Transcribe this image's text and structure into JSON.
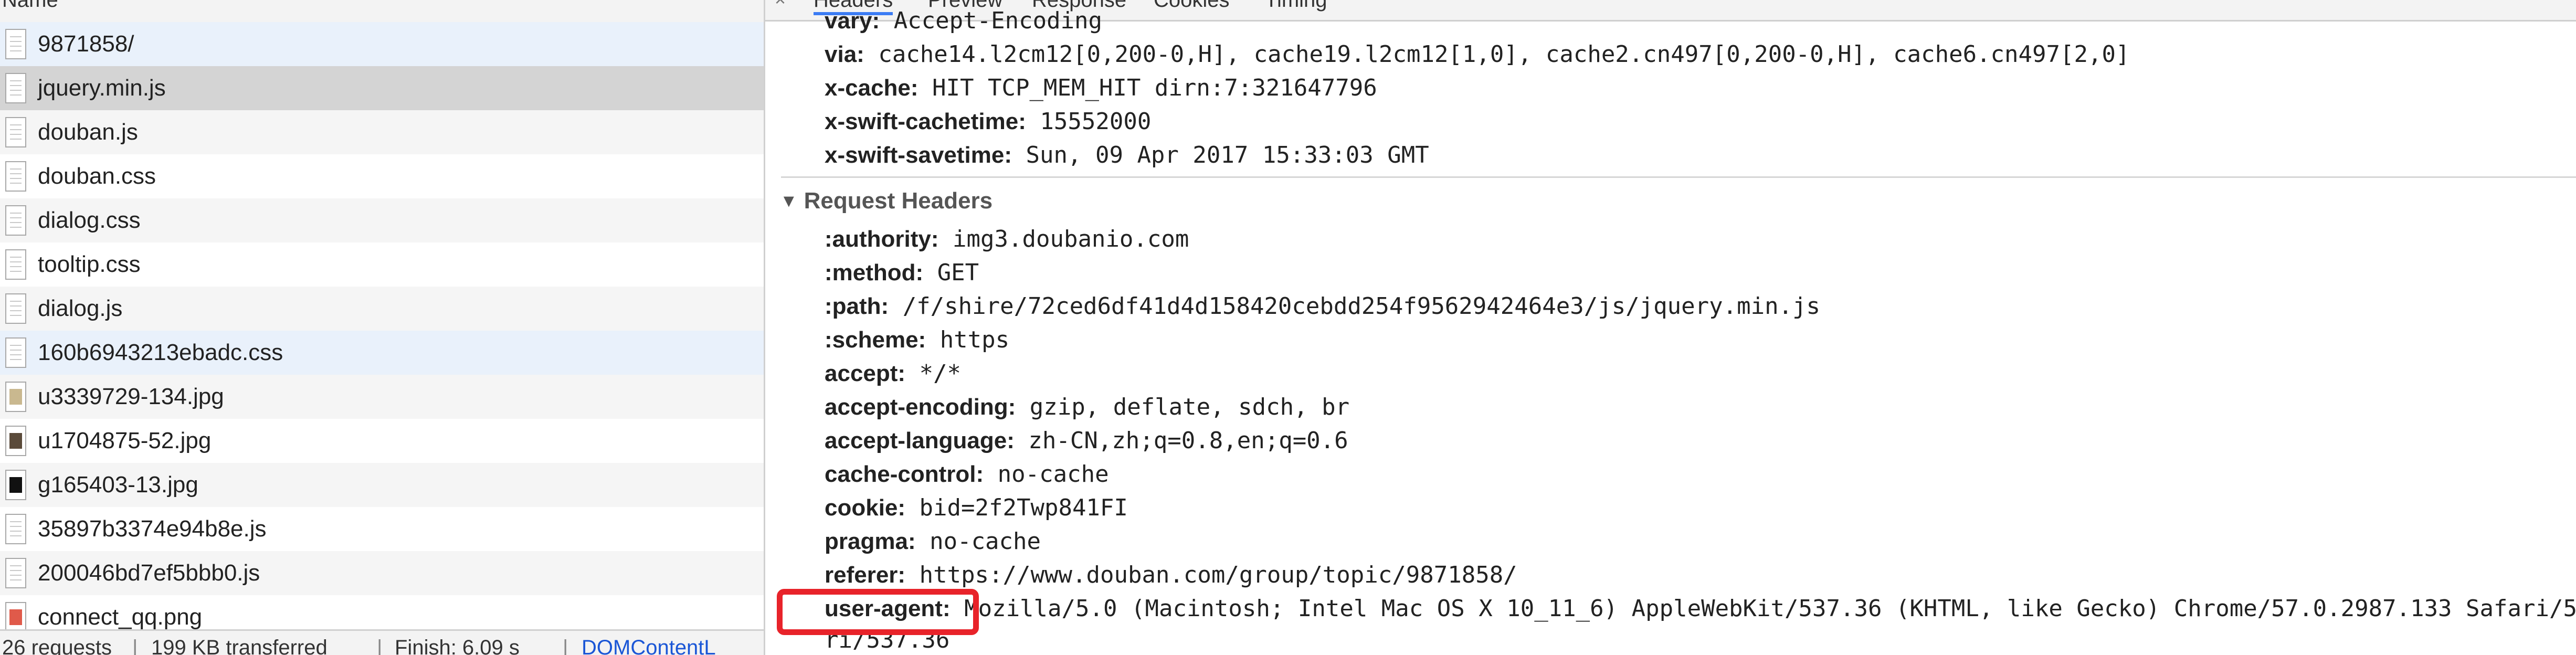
{
  "left_panel": {
    "header_label": "Name",
    "files": [
      {
        "name": "9871858/",
        "type": "doc",
        "bg": "#e9f1fb"
      },
      {
        "name": "jquery.min.js",
        "type": "doc",
        "bg": "#d4d4d4"
      },
      {
        "name": "douban.js",
        "type": "doc",
        "bg": "#f5f5f5"
      },
      {
        "name": "douban.css",
        "type": "doc",
        "bg": "#ffffff"
      },
      {
        "name": "dialog.css",
        "type": "doc",
        "bg": "#f5f5f5"
      },
      {
        "name": "tooltip.css",
        "type": "doc",
        "bg": "#ffffff"
      },
      {
        "name": "dialog.js",
        "type": "doc",
        "bg": "#f5f5f5"
      },
      {
        "name": "160b6943213ebadc.css",
        "type": "doc",
        "bg": "#e9f1fb"
      },
      {
        "name": "u3339729-134.jpg",
        "type": "img",
        "thumb": "#c9b88f",
        "bg": "#f5f5f5"
      },
      {
        "name": "u1704875-52.jpg",
        "type": "img",
        "thumb": "#5a4a3a",
        "bg": "#ffffff"
      },
      {
        "name": "g165403-13.jpg",
        "type": "img",
        "thumb": "#111111",
        "bg": "#f5f5f5"
      },
      {
        "name": "35897b3374e94b8e.js",
        "type": "doc",
        "bg": "#ffffff"
      },
      {
        "name": "200046bd7ef5bbb0.js",
        "type": "doc",
        "bg": "#f5f5f5"
      },
      {
        "name": "connect_qq.png",
        "type": "img",
        "thumb": "#e05a4a",
        "bg": "#ffffff"
      }
    ],
    "footer": {
      "requests": "26 requests",
      "transferred": "199 KB transferred",
      "finish": "Finish: 6.09 s",
      "dcl": "DOMContentL",
      "separator": "|"
    }
  },
  "tabs": {
    "headers": "Headers",
    "preview": "Preview",
    "response": "Response",
    "cookies": "Cookies",
    "timing": "Timing",
    "close": "×"
  },
  "response_headers": [
    {
      "key": "vary:",
      "value": "Accept-Encoding"
    },
    {
      "key": "via:",
      "value": "cache14.l2cm12[0,200-0,H], cache19.l2cm12[1,0], cache2.cn497[0,200-0,H], cache6.cn497[2,0]"
    },
    {
      "key": "x-cache:",
      "value": "HIT TCP_MEM_HIT dirn:7:321647796"
    },
    {
      "key": "x-swift-cachetime:",
      "value": "15552000"
    },
    {
      "key": "x-swift-savetime:",
      "value": "Sun, 09 Apr 2017 15:33:03 GMT"
    }
  ],
  "request_section": {
    "title": "Request Headers",
    "toggle": "▼",
    "headers": [
      {
        "key": ":authority:",
        "value": "img3.doubanio.com"
      },
      {
        "key": ":method:",
        "value": "GET"
      },
      {
        "key": ":path:",
        "value": "/f/shire/72ced6df41d4d158420cebdd254f9562942464e3/js/jquery.min.js"
      },
      {
        "key": ":scheme:",
        "value": "https"
      },
      {
        "key": "accept:",
        "value": "*/*"
      },
      {
        "key": "accept-encoding:",
        "value": "gzip, deflate, sdch, br"
      },
      {
        "key": "accept-language:",
        "value": "zh-CN,zh;q=0.8,en;q=0.6"
      },
      {
        "key": "cache-control:",
        "value": "no-cache"
      },
      {
        "key": "cookie:",
        "value": "bid=2f2Twp841FI"
      },
      {
        "key": "pragma:",
        "value": "no-cache"
      },
      {
        "key": "referer:",
        "value": "https://www.douban.com/group/topic/9871858/"
      },
      {
        "key": "user-agent:",
        "value": "Mozilla/5.0 (Macintosh; Intel Mac OS X 10_11_6) AppleWebKit/537.36 (KHTML, like Gecko) Chrome/57.0.2987.133 Safari/537.36"
      }
    ],
    "wrap_line": "ri/537.36"
  },
  "colors": {
    "highlight": "#e8232a",
    "selected_row": "#d4d4d4",
    "link": "#1a56d6"
  }
}
